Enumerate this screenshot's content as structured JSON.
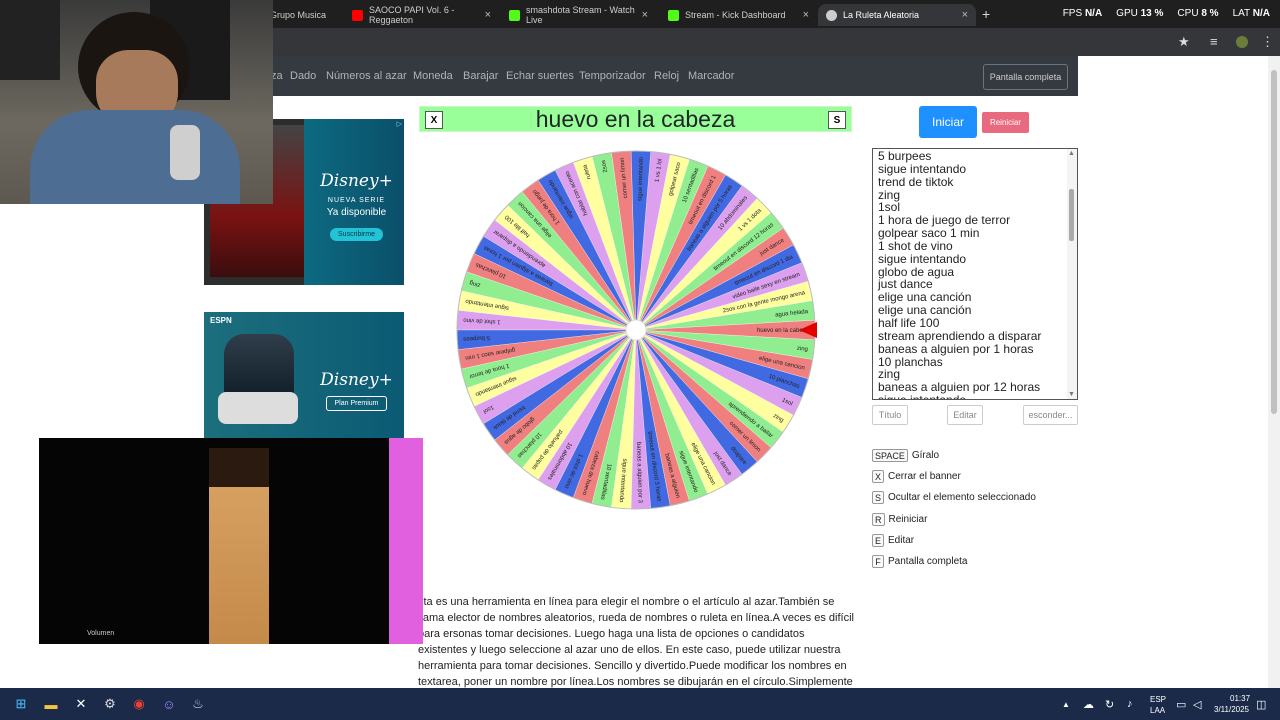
{
  "tabs": [
    {
      "label": "Grupo Musica",
      "fav": "#1db954"
    },
    {
      "label": "SAOCO PAPI Vol. 6 - Reggaeton",
      "fav": "#ff0000"
    },
    {
      "label": "smashdota Stream - Watch Live",
      "fav": "#53fc18"
    },
    {
      "label": "Stream - Kick Dashboard",
      "fav": "#53fc18"
    },
    {
      "label": "La Ruleta Aleatoria",
      "fav": "#cccccc"
    }
  ],
  "stats": {
    "fps_label": "FPS",
    "fps": "N/A",
    "gpu_label": "GPU",
    "gpu": "13 %",
    "cpu_label": "CPU",
    "cpu": "8 %",
    "lat_label": "LAT",
    "lat": "N/A"
  },
  "nav": {
    "items": [
      "za",
      "Dado",
      "Números al azar",
      "Moneda",
      "Barajar",
      "Echar suertes",
      "Temporizador",
      "Reloj",
      "Marcador"
    ],
    "fullscreen": "Pantalla completa"
  },
  "banner": {
    "x_key": "X",
    "text": "huevo en la cabeza",
    "s_key": "S"
  },
  "buttons": {
    "start": "Iniciar",
    "reset": "Reiniciar",
    "title": "Título",
    "edit": "Editar",
    "hide": "esconder..."
  },
  "names": [
    "5 burpees",
    "sigue intentando",
    "trend de tiktok",
    "zing",
    "1sol",
    "1 hora de juego de terror",
    "golpear saco 1 min",
    "1 shot de vino",
    "sigue intentando",
    "globo de agua",
    "just dance",
    "elige una canción",
    "elige una canción",
    "half life 100",
    "stream aprendiendo a disparar",
    "baneas a alguien por 1 horas",
    "10 planchas",
    "zing",
    "baneas a alguien por 12 horas",
    "sigue intentando"
  ],
  "shortcuts": [
    {
      "key": "SPACE",
      "label": "Gíralo"
    },
    {
      "key": "X",
      "label": "Cerrar el banner"
    },
    {
      "key": "S",
      "label": "Ocultar el elemento seleccionado"
    },
    {
      "key": "R",
      "label": "Reiniciar"
    },
    {
      "key": "E",
      "label": "Editar"
    },
    {
      "key": "F",
      "label": "Pantalla completa"
    }
  ],
  "description": "sta es una herramienta en línea para elegir el nombre o el artículo al azar.También se llama elector de nombres aleatorios, rueda de nombres o ruleta en línea.A veces es difícil para ersonas tomar decisiones. Luego haga una lista de opciones o candidatos existentes y luego seleccione al azar uno de ellos. En este caso, puede utilizar nuestra herramienta para tomar decisiones. Sencillo y divertido.Puede modificar los nombres en textarea, poner un nombre por línea.Los nombres se dibujarán en el círculo.Simplemente haga clic en la rueda",
  "wheel": {
    "colors": [
      "#f08080",
      "#90ee90",
      "#ffffa0",
      "#dda0ee",
      "#4169e1"
    ],
    "labels": [
      "huevo en la cabeza",
      "agua helada",
      "2sos con la gente mongo arena",
      "video baile sexy en stream",
      "timeout en discord 1 dia",
      "just dance",
      "timeout en discord 12 horas",
      "1 vs 1 dota",
      "10 abdominales",
      "baneas a alguien por 5 horas",
      "timeout en discord 1",
      "10 sentadillas",
      "golpear saco",
      "1 vs 1 lol",
      "sigue intentando",
      "comer un limon",
      "2sos",
      "ruleta",
      "hablar con acento",
      "sigue intentando",
      "1 hora de juego",
      "elige una cancion",
      "half life 100",
      "aprendiendo a disparar",
      "baneas a alguien por 1 horas",
      "10 planchas",
      "zing",
      "sigue intentando",
      "1 shot de vino",
      "5 burpees",
      "golpear saco 1 min",
      "1 hora de terror",
      "sigue intentando",
      "1sol",
      "trend de tiktok",
      "globo de agua",
      "10 planchas",
      "pañuelo de papas",
      "10 abdominales",
      "1 shot de vino",
      "cabeza de huevo",
      "10 sentadillas",
      "sigue intentando",
      "baneas a alguien por 3",
      "timeout en discord 3 horas",
      "baneas a alguien",
      "sigue intentando",
      "elige una cancion",
      "just dance",
      "dsapare",
      "comer un limon",
      "aprendiendo a bailar",
      "zing",
      "1sol",
      "10 planchas",
      "elige una cancion",
      "zing"
    ],
    "selected_index": 0,
    "pointer_color": "#e00000"
  },
  "ads": [
    {
      "brand": "Disney+",
      "line1": "NUEVA SERIE",
      "line2": "Ya disponible",
      "cta": "Suscribirme"
    },
    {
      "brand": "Disney+",
      "line1": "",
      "line2": "Plan Premium",
      "cta": "",
      "sponsor": "ESPN"
    }
  ],
  "video": {
    "overlay": "Volumen"
  },
  "taskbar": {
    "lang": "ESP",
    "region": "LAA",
    "time": "01:37",
    "date": "3/11/2025"
  }
}
